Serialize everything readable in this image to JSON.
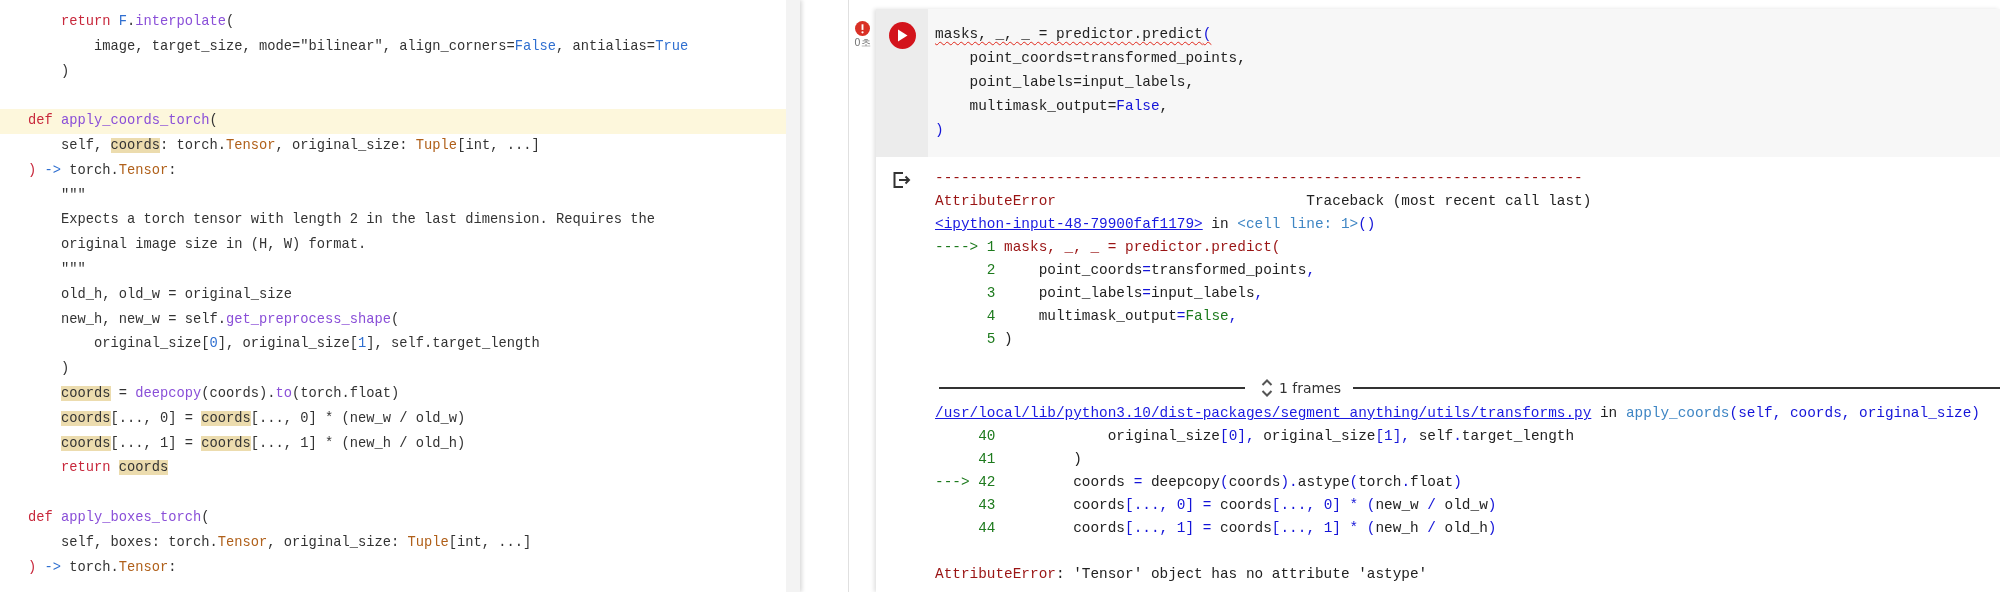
{
  "editor": {
    "lines": [
      {
        "kind": "code",
        "highlighted": false,
        "tokens": [
          {
            "text": "    return ",
            "kind": "keyword"
          },
          {
            "text": "F",
            "kind": "constant"
          },
          {
            "text": ".",
            "kind": "plain"
          },
          {
            "text": "interpolate",
            "kind": "function"
          },
          {
            "text": "(",
            "kind": "plain"
          }
        ]
      },
      {
        "kind": "code",
        "highlighted": false,
        "tokens": [
          {
            "text": "        image, target_size, mode=\"bilinear\", align_corners=",
            "kind": "plain"
          },
          {
            "text": "False",
            "kind": "constant"
          },
          {
            "text": ", antialias=",
            "kind": "plain"
          },
          {
            "text": "True",
            "kind": "constant"
          }
        ]
      },
      {
        "kind": "code",
        "highlighted": false,
        "tokens": [
          {
            "text": "    )",
            "kind": "plain"
          }
        ]
      },
      {
        "kind": "blank",
        "highlighted": false
      },
      {
        "kind": "code",
        "highlighted": true,
        "tokens": [
          {
            "text": "def ",
            "kind": "keyword"
          },
          {
            "text": "apply_coords_torch",
            "kind": "function"
          },
          {
            "text": "(",
            "kind": "plain"
          }
        ]
      },
      {
        "kind": "code",
        "highlighted": false,
        "tokens": [
          {
            "text": "    self, ",
            "kind": "plain"
          },
          {
            "text": "coords",
            "kind": "match"
          },
          {
            "text": ": torch.",
            "kind": "plain"
          },
          {
            "text": "Tensor",
            "kind": "type"
          },
          {
            "text": ", original_size: ",
            "kind": "plain"
          },
          {
            "text": "Tuple",
            "kind": "type"
          },
          {
            "text": "[int, ...]",
            "kind": "plain"
          }
        ]
      },
      {
        "kind": "code",
        "highlighted": false,
        "tokens": [
          {
            "text": ") ",
            "kind": "keyword"
          },
          {
            "text": "->",
            "kind": "constant"
          },
          {
            "text": " torch.",
            "kind": "plain"
          },
          {
            "text": "Tensor",
            "kind": "type"
          },
          {
            "text": ":",
            "kind": "plain"
          }
        ]
      },
      {
        "kind": "code",
        "highlighted": false,
        "tokens": [
          {
            "text": "    \"\"\"",
            "kind": "plain"
          }
        ]
      },
      {
        "kind": "code",
        "highlighted": false,
        "tokens": [
          {
            "text": "    Expects a torch tensor with length 2 in the last dimension. Requires the",
            "kind": "plain"
          }
        ]
      },
      {
        "kind": "code",
        "highlighted": false,
        "tokens": [
          {
            "text": "    original image size in (H, W) format.",
            "kind": "plain"
          }
        ]
      },
      {
        "kind": "code",
        "highlighted": false,
        "tokens": [
          {
            "text": "    \"\"\"",
            "kind": "plain"
          }
        ]
      },
      {
        "kind": "code",
        "highlighted": false,
        "tokens": [
          {
            "text": "    old_h, old_w = original_size",
            "kind": "plain"
          }
        ]
      },
      {
        "kind": "code",
        "highlighted": false,
        "tokens": [
          {
            "text": "    new_h, new_w = self.",
            "kind": "plain"
          },
          {
            "text": "get_preprocess_shape",
            "kind": "function"
          },
          {
            "text": "(",
            "kind": "plain"
          }
        ]
      },
      {
        "kind": "code",
        "highlighted": false,
        "tokens": [
          {
            "text": "        original_size[",
            "kind": "plain"
          },
          {
            "text": "0",
            "kind": "constant"
          },
          {
            "text": "], original_size[",
            "kind": "plain"
          },
          {
            "text": "1",
            "kind": "constant"
          },
          {
            "text": "], self.target_length",
            "kind": "plain"
          }
        ]
      },
      {
        "kind": "code",
        "highlighted": false,
        "tokens": [
          {
            "text": "    )",
            "kind": "plain"
          }
        ]
      },
      {
        "kind": "code",
        "highlighted": false,
        "tokens": [
          {
            "text": "    coords",
            "kind": "match"
          },
          {
            "text": " = ",
            "kind": "plain"
          },
          {
            "text": "deepcopy",
            "kind": "function"
          },
          {
            "text": "(coords).",
            "kind": "plain"
          },
          {
            "text": "to",
            "kind": "function"
          },
          {
            "text": "(torch.float)",
            "kind": "plain"
          }
        ]
      },
      {
        "kind": "code",
        "highlighted": false,
        "tokens": [
          {
            "text": "    coords",
            "kind": "match"
          },
          {
            "text": "[..., 0] = ",
            "kind": "plain"
          },
          {
            "text": "coords",
            "kind": "match"
          },
          {
            "text": "[..., 0] * (new_w / old_w)",
            "kind": "plain"
          }
        ]
      },
      {
        "kind": "code",
        "highlighted": false,
        "tokens": [
          {
            "text": "    coords",
            "kind": "match"
          },
          {
            "text": "[..., 1] = ",
            "kind": "plain"
          },
          {
            "text": "coords",
            "kind": "match"
          },
          {
            "text": "[..., 1] * (new_h / old_h)",
            "kind": "plain"
          }
        ]
      },
      {
        "kind": "code",
        "highlighted": false,
        "tokens": [
          {
            "text": "    return ",
            "kind": "keyword"
          },
          {
            "text": "coords",
            "kind": "match"
          }
        ]
      },
      {
        "kind": "blank",
        "highlighted": false
      },
      {
        "kind": "code",
        "highlighted": false,
        "tokens": [
          {
            "text": "def ",
            "kind": "keyword"
          },
          {
            "text": "apply_boxes_torch",
            "kind": "function"
          },
          {
            "text": "(",
            "kind": "plain"
          }
        ]
      },
      {
        "kind": "code",
        "highlighted": false,
        "tokens": [
          {
            "text": "    self, boxes: torch.",
            "kind": "plain"
          },
          {
            "text": "Tensor",
            "kind": "type"
          },
          {
            "text": ", original_size: ",
            "kind": "plain"
          },
          {
            "text": "Tuple",
            "kind": "type"
          },
          {
            "text": "[int, ...]",
            "kind": "plain"
          }
        ]
      },
      {
        "kind": "code",
        "highlighted": false,
        "tokens": [
          {
            "text": ") ",
            "kind": "keyword"
          },
          {
            "text": "->",
            "kind": "constant"
          },
          {
            "text": " torch.",
            "kind": "plain"
          },
          {
            "text": "Tensor",
            "kind": "type"
          },
          {
            "text": ":",
            "kind": "plain"
          }
        ]
      }
    ]
  },
  "notebook": {
    "cell": {
      "error": true,
      "execution_time": "0초",
      "code": [
        {
          "squiggly": true,
          "tokens": [
            {
              "text": "masks, _, _ = predictor.predict",
              "kind": "plain"
            },
            {
              "text": "(",
              "kind": "ansi_blue"
            }
          ]
        },
        {
          "squiggly": false,
          "tokens": [
            {
              "text": "    point_coords=transformed_points,",
              "kind": "plain"
            }
          ]
        },
        {
          "squiggly": false,
          "tokens": [
            {
              "text": "    point_labels=input_labels,",
              "kind": "plain"
            }
          ]
        },
        {
          "squiggly": false,
          "tokens": [
            {
              "text": "    multimask_output=",
              "kind": "plain"
            },
            {
              "text": "False",
              "kind": "ansi_blue"
            },
            {
              "text": ",",
              "kind": "plain"
            }
          ]
        },
        {
          "squiggly": false,
          "tokens": [
            {
              "text": ")",
              "kind": "ansi_blue"
            }
          ]
        }
      ],
      "output": {
        "traceback": [
          {
            "tokens": [
              {
                "text": "---------------------------------------------------------------------------",
                "kind": "ansi_red"
              }
            ]
          },
          {
            "tokens": [
              {
                "text": "AttributeError",
                "kind": "ansi_red"
              },
              {
                "text": "                             Traceback (most recent call last)",
                "kind": "plain"
              }
            ]
          },
          {
            "tokens": [
              {
                "text": "<ipython-input-48-79900faf1179>",
                "kind": "link"
              },
              {
                "text": " in ",
                "kind": "plain"
              },
              {
                "text": "<cell line: 1>",
                "kind": "ansi_cyan"
              },
              {
                "text": "()",
                "kind": "ansi_blue"
              }
            ]
          },
          {
            "tokens": [
              {
                "text": "----> 1 ",
                "kind": "ansi_green"
              },
              {
                "text": "masks, _, _ = predictor.predict(",
                "kind": "ansi_red"
              }
            ]
          },
          {
            "tokens": [
              {
                "text": "      2",
                "kind": "ansi_green"
              },
              {
                "text": "     point_coords",
                "kind": "plain"
              },
              {
                "text": "=",
                "kind": "ansi_blue"
              },
              {
                "text": "transformed_points",
                "kind": "plain"
              },
              {
                "text": ",",
                "kind": "ansi_blue"
              }
            ]
          },
          {
            "tokens": [
              {
                "text": "      3",
                "kind": "ansi_green"
              },
              {
                "text": "     point_labels",
                "kind": "plain"
              },
              {
                "text": "=",
                "kind": "ansi_blue"
              },
              {
                "text": "input_labels",
                "kind": "plain"
              },
              {
                "text": ",",
                "kind": "ansi_blue"
              }
            ]
          },
          {
            "tokens": [
              {
                "text": "      4",
                "kind": "ansi_green"
              },
              {
                "text": "     multimask_output",
                "kind": "plain"
              },
              {
                "text": "=",
                "kind": "ansi_blue"
              },
              {
                "text": "False",
                "kind": "ansi_green"
              },
              {
                "text": ",",
                "kind": "ansi_blue"
              }
            ]
          },
          {
            "tokens": [
              {
                "text": "      5",
                "kind": "ansi_green"
              },
              {
                "text": " )",
                "kind": "plain"
              }
            ]
          }
        ],
        "frames": {
          "label": "1 frames"
        },
        "frame_lines": [
          {
            "tokens": [
              {
                "text": "/usr/local/lib/python3.10/dist-packages/segment_anything/utils/transforms.py",
                "kind": "link"
              },
              {
                "text": " in ",
                "kind": "plain"
              },
              {
                "text": "apply_coords",
                "kind": "ansi_cyan"
              },
              {
                "text": "(self, coords, original_size)",
                "kind": "ansi_blue"
              }
            ]
          },
          {
            "tokens": [
              {
                "text": "     40",
                "kind": "ansi_green"
              },
              {
                "text": "             original_size",
                "kind": "plain"
              },
              {
                "text": "[0], ",
                "kind": "ansi_blue"
              },
              {
                "text": "original_size",
                "kind": "plain"
              },
              {
                "text": "[1], ",
                "kind": "ansi_blue"
              },
              {
                "text": "self",
                "kind": "plain"
              },
              {
                "text": ".",
                "kind": "ansi_blue"
              },
              {
                "text": "target_length",
                "kind": "plain"
              }
            ]
          },
          {
            "tokens": [
              {
                "text": "     41",
                "kind": "ansi_green"
              },
              {
                "text": "         )",
                "kind": "plain"
              }
            ]
          },
          {
            "tokens": [
              {
                "text": "---> 42",
                "kind": "ansi_green"
              },
              {
                "text": "         coords ",
                "kind": "plain"
              },
              {
                "text": "=",
                "kind": "ansi_blue"
              },
              {
                "text": " deepcopy",
                "kind": "plain"
              },
              {
                "text": "(",
                "kind": "ansi_blue"
              },
              {
                "text": "coords",
                "kind": "plain"
              },
              {
                "text": ").",
                "kind": "ansi_blue"
              },
              {
                "text": "astype",
                "kind": "plain"
              },
              {
                "text": "(",
                "kind": "ansi_blue"
              },
              {
                "text": "torch",
                "kind": "plain"
              },
              {
                "text": ".",
                "kind": "ansi_blue"
              },
              {
                "text": "float",
                "kind": "plain"
              },
              {
                "text": ")",
                "kind": "ansi_blue"
              }
            ]
          },
          {
            "tokens": [
              {
                "text": "     43",
                "kind": "ansi_green"
              },
              {
                "text": "         coords",
                "kind": "plain"
              },
              {
                "text": "[..., 0]",
                "kind": "ansi_blue"
              },
              {
                "text": " =",
                "kind": "ansi_blue"
              },
              {
                "text": " coords",
                "kind": "plain"
              },
              {
                "text": "[..., 0] * (",
                "kind": "ansi_blue"
              },
              {
                "text": "new_w ",
                "kind": "plain"
              },
              {
                "text": "/",
                "kind": "ansi_blue"
              },
              {
                "text": " old_w",
                "kind": "plain"
              },
              {
                "text": ")",
                "kind": "ansi_blue"
              }
            ]
          },
          {
            "tokens": [
              {
                "text": "     44",
                "kind": "ansi_green"
              },
              {
                "text": "         coords",
                "kind": "plain"
              },
              {
                "text": "[..., 1]",
                "kind": "ansi_blue"
              },
              {
                "text": " =",
                "kind": "ansi_blue"
              },
              {
                "text": " coords",
                "kind": "plain"
              },
              {
                "text": "[..., 1] * (",
                "kind": "ansi_blue"
              },
              {
                "text": "new_h ",
                "kind": "plain"
              },
              {
                "text": "/",
                "kind": "ansi_blue"
              },
              {
                "text": " old_h",
                "kind": "plain"
              },
              {
                "text": ")",
                "kind": "ansi_blue"
              }
            ]
          }
        ],
        "error_message": [
          {
            "text": "AttributeError",
            "kind": "ansi_red"
          },
          {
            "text": ": 'Tensor' object has no attribute 'astype'",
            "kind": "plain"
          }
        ]
      }
    }
  }
}
